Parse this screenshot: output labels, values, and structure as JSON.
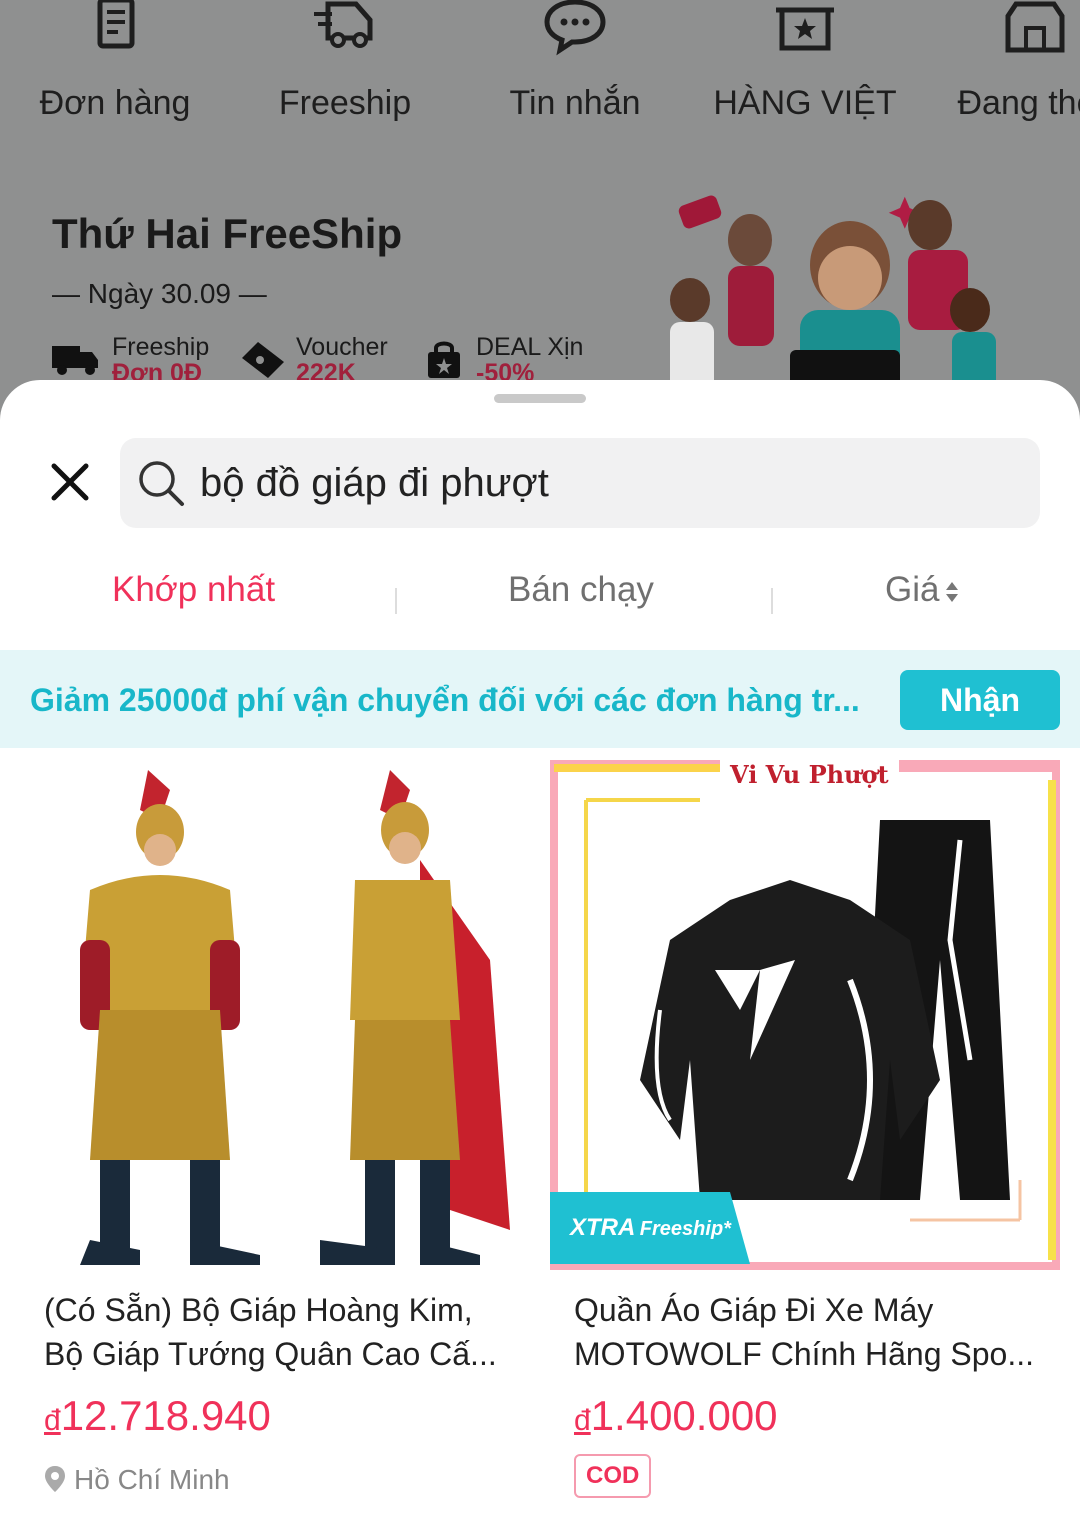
{
  "top_nav": [
    {
      "label": "Đơn hàng",
      "icon": "order-icon"
    },
    {
      "label": "Freeship",
      "icon": "truck-icon"
    },
    {
      "label": "Tin nhắn",
      "icon": "chat-icon"
    },
    {
      "label": "HÀNG VIỆT",
      "icon": "star-basket-icon"
    },
    {
      "label": "Đang thec",
      "icon": "store-icon"
    }
  ],
  "banner": {
    "title": "Thứ Hai FreeShip",
    "date": "— Ngày 30.09 —",
    "perks": [
      {
        "label": "Freeship",
        "sub": "Đơn 0Đ"
      },
      {
        "label": "Voucher",
        "sub": "222K"
      },
      {
        "label": "DEAL Xịn",
        "sub": "-50%"
      }
    ]
  },
  "search": {
    "query": "bộ đồ giáp đi phượt"
  },
  "tabs": [
    {
      "label": "Khớp nhất",
      "active": true
    },
    {
      "label": "Bán chạy",
      "active": false
    },
    {
      "label": "Giá",
      "active": false
    }
  ],
  "promo": {
    "text": "Giảm 25000đ phí vận chuyển đối với các đơn hàng tr...",
    "button": "Nhận"
  },
  "products": [
    {
      "title_line1": "(Có Sẵn) Bộ Giáp Hoàng Kim,",
      "title_line2": "Bộ Giáp Tướng Quân Cao Cấ...",
      "currency": "đ",
      "price": "12.718.940",
      "location": "Hồ Chí Minh"
    },
    {
      "title_line1": "Quần Áo Giáp Đi Xe Máy",
      "title_line2": "MOTOWOLF Chính Hãng Spo...",
      "currency": "đ",
      "price": "1.400.000",
      "badge": "COD",
      "image_brand": "Vi Vu Phượt",
      "freeship_tag_a": "XTRA",
      "freeship_tag_b": "Freeship*"
    }
  ],
  "colors": {
    "accent": "#f0315a",
    "teal": "#1fc0d2",
    "promo_bg": "#e4f6f8"
  }
}
